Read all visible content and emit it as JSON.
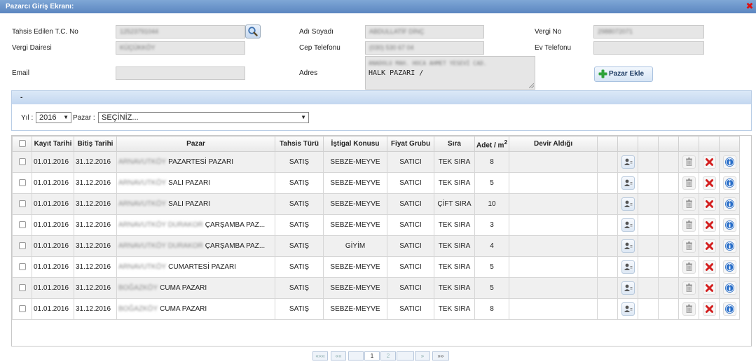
{
  "window": {
    "title": "Pazarcı Giriş Ekranı:"
  },
  "form": {
    "tc_label": "Tahsis Edilen T.C. No",
    "tc_value": "12523791044",
    "name_label": "Adı Soyadı",
    "name_value": "ABDULLATİF DİNÇ",
    "tax_no_label": "Vergi No",
    "tax_no_value": "2988072071",
    "tax_office_label": "Vergi Dairesi",
    "tax_office_value": "KÜÇÜKKÖY",
    "cell_label": "Cep Telefonu",
    "cell_value": "(030) 530 67 04",
    "home_phone_label": "Ev Telefonu",
    "email_label": "Email",
    "address_label": "Adres",
    "address_line1": "ANADOLU MAH. HOCA AHMET YESEVİ CAD.",
    "address_line2": "HALK PAZARI /",
    "add_market_label": "Pazar Ekle"
  },
  "panel": {
    "title": "-",
    "year_label": "Yıl :",
    "year_value": "2016",
    "market_label": "Pazar :",
    "market_value": "SEÇİNİZ..."
  },
  "table": {
    "headers": {
      "kayit": "Kayıt Tarihi",
      "bitis": "Bitiş Tarihi",
      "pazar": "Pazar",
      "tahsis": "Tahsis Türü",
      "istigal": "İştigal Konusu",
      "fiyat": "Fiyat Grubu",
      "sira": "Sıra",
      "adet": "Adet / m",
      "adet_sup": "2",
      "devir": "Devir Aldığı"
    },
    "rows": [
      {
        "kayit": "01.01.2016",
        "bitis": "31.12.2016",
        "prefix": "ARNAVUTKÖY",
        "pazar": "PAZARTESİ PAZARI",
        "tahsis": "SATIŞ",
        "istigal": "SEBZE-MEYVE",
        "fiyat": "SATICI",
        "sira": "TEK SIRA",
        "adet": "8"
      },
      {
        "kayit": "01.01.2016",
        "bitis": "31.12.2016",
        "prefix": "ARNAVUTKÖY",
        "pazar": "SALI PAZARI",
        "tahsis": "SATIŞ",
        "istigal": "SEBZE-MEYVE",
        "fiyat": "SATICI",
        "sira": "TEK SIRA",
        "adet": "5"
      },
      {
        "kayit": "01.01.2016",
        "bitis": "31.12.2016",
        "prefix": "ARNAVUTKÖY",
        "pazar": "SALI PAZARI",
        "tahsis": "SATIŞ",
        "istigal": "SEBZE-MEYVE",
        "fiyat": "SATICI",
        "sira": "ÇİFT SIRA",
        "adet": "10"
      },
      {
        "kayit": "01.01.2016",
        "bitis": "31.12.2016",
        "prefix": "ARNAVUTKÖY DURAKOR",
        "pazar": "ÇARŞAMBA PAZ...",
        "tahsis": "SATIŞ",
        "istigal": "SEBZE-MEYVE",
        "fiyat": "SATICI",
        "sira": "TEK SIRA",
        "adet": "3"
      },
      {
        "kayit": "01.01.2016",
        "bitis": "31.12.2016",
        "prefix": "ARNAVUTKÖY DURAKOR",
        "pazar": "ÇARŞAMBA PAZ...",
        "tahsis": "SATIŞ",
        "istigal": "GİYİM",
        "fiyat": "SATICI",
        "sira": "TEK SIRA",
        "adet": "4"
      },
      {
        "kayit": "01.01.2016",
        "bitis": "31.12.2016",
        "prefix": "ARNAVUTKÖY",
        "pazar": "CUMARTESİ PAZARI",
        "tahsis": "SATIŞ",
        "istigal": "SEBZE-MEYVE",
        "fiyat": "SATICI",
        "sira": "TEK SIRA",
        "adet": "5"
      },
      {
        "kayit": "01.01.2016",
        "bitis": "31.12.2016",
        "prefix": "BOĞAZKÖY",
        "pazar": "CUMA PAZARI",
        "tahsis": "SATIŞ",
        "istigal": "SEBZE-MEYVE",
        "fiyat": "SATICI",
        "sira": "TEK SIRA",
        "adet": "5"
      },
      {
        "kayit": "01.01.2016",
        "bitis": "31.12.2016",
        "prefix": "BOĞAZKÖY",
        "pazar": "CUMA PAZARI",
        "tahsis": "SATIŞ",
        "istigal": "SEBZE-MEYVE",
        "fiyat": "SATICI",
        "sira": "TEK SIRA",
        "adet": "8"
      }
    ]
  },
  "pager": {
    "first": "«««",
    "prev": "««",
    "page1": "1",
    "page2": "2",
    "next": "»",
    "last": "»»"
  },
  "colors": {
    "title_bar": "#5b86c0",
    "accent": "#c3d7f0",
    "delete_red": "#d42020",
    "info_blue": "#2a6fc9"
  }
}
